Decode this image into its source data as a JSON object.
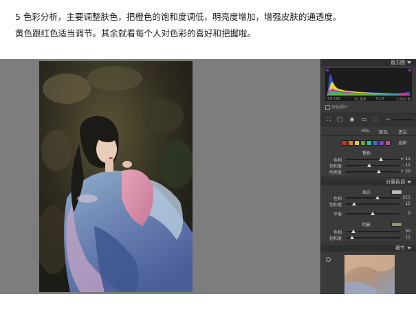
{
  "caption": {
    "line1": "5 色彩分析，主要调整肤色，把橙色的饱和度调低，明亮度增加，增强皮肤的通透度。",
    "line2": "黄色跟红色适当调节。其余就看每个人对色彩的喜好和把握啦。"
  },
  "panel": {
    "histogram_title": "直方图",
    "readout": {
      "iso": "ISO 160",
      "focal": "35 毫米",
      "aperture": "f/1.8",
      "shutter": "1/500 秒"
    },
    "original_photo_label": "原始照片",
    "tools": [
      "crop-icon",
      "spot-removal-icon",
      "red-eye-icon",
      "graduated-filter-icon",
      "radial-filter-icon",
      "brush-icon"
    ],
    "hsl_tabs": [
      "HSL",
      "颜色",
      "黑白"
    ],
    "swatch_colors": [
      "#d0342c",
      "#e07b2b",
      "#e3c93a",
      "#5aa83a",
      "#3fb2a8",
      "#3a6fd0",
      "#7a48c8",
      "#c448a8"
    ],
    "all_label": "全部",
    "orange": {
      "label": "橙色",
      "sliders": [
        {
          "name": "色相",
          "value": "+ 11",
          "pos": 0.66
        },
        {
          "name": "饱和度",
          "value": "- 11",
          "pos": 0.43
        },
        {
          "name": "明亮度",
          "value": "+ 20",
          "pos": 0.62
        }
      ]
    },
    "split_toning": {
      "title": "分离色调",
      "highlights_label": "高光",
      "highlight_color": "#bdbdbd",
      "highlight_sliders": [
        {
          "name": "色相",
          "value": "211",
          "pos": 0.59
        },
        {
          "name": "饱和度",
          "value": "15",
          "pos": 0.15
        }
      ],
      "balance": {
        "name": "平衡",
        "value": "0",
        "pos": 0.5
      },
      "shadows_label": "阴影",
      "shadow_color": "#8f9670",
      "shadow_sliders": [
        {
          "name": "色相",
          "value": "50",
          "pos": 0.14
        },
        {
          "name": "饱和度",
          "value": "11",
          "pos": 0.11
        }
      ]
    },
    "detail_title": "细节"
  }
}
